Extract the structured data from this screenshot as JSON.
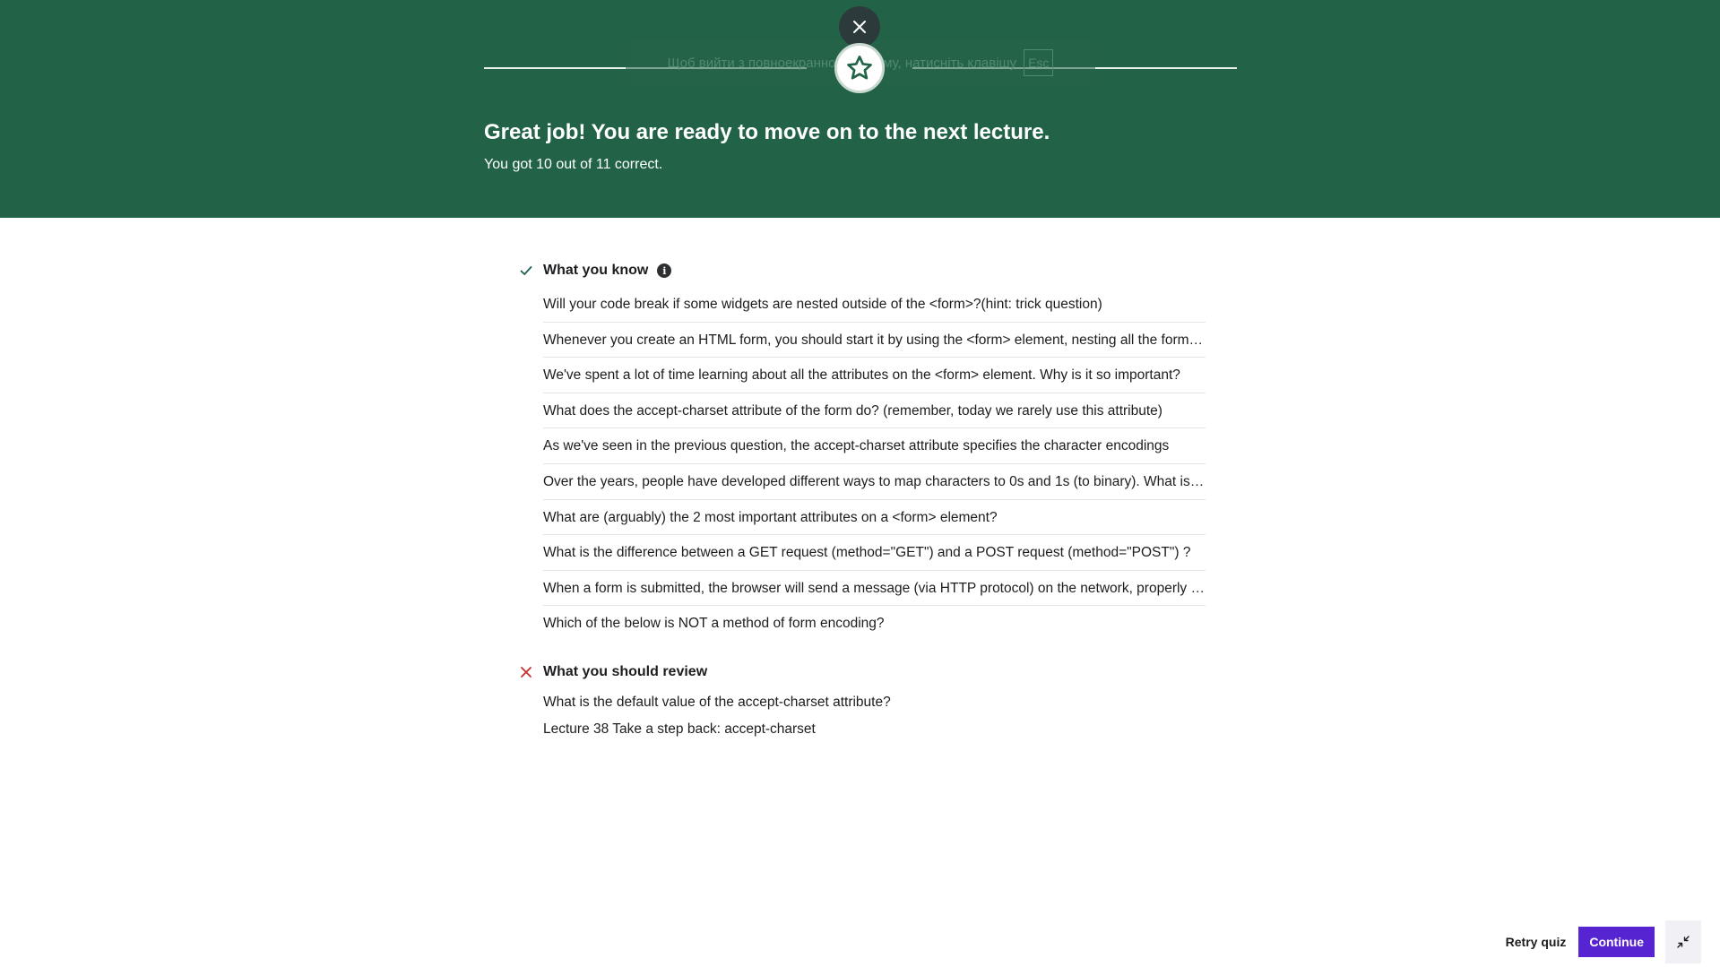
{
  "fullscreen_notice": {
    "text": "Щоб вийти з повноекранного режиму, натисніть клавішу",
    "key": "Esc"
  },
  "banner": {
    "title": "Great job! You are ready to move on to the next lecture.",
    "subtitle": "You got 10 out of 11 correct."
  },
  "know": {
    "label": "What you know",
    "items": [
      "Will your code break if some widgets are nested outside of the <form>?(hint: trick question)",
      "Whenever you create an HTML form, you should start it by using the <form> element, nesting all the form widgets inside it",
      "We've spent a lot of time learning about all the attributes on the <form> element. Why is it so important?",
      "What does the accept-charset attribute of the form do? (remember, today we rarely use this attribute)",
      "As we've seen in the previous question, the accept-charset attribute specifies the character encodings",
      "Over the years, people have developed different ways to map characters to 0s and 1s (to binary). What is this called?",
      "What are (arguably) the 2 most important attributes on a <form> element?",
      "What is the difference between a GET request (method=\"GET\") and a POST request (method=\"POST\") ?",
      "When a form is submitted, the browser will send a message (via HTTP protocol) on the network, properly formatted",
      "Which of the below is NOT a method of form encoding?"
    ]
  },
  "review": {
    "label": "What you should review",
    "question": "What is the default value of the accept-charset attribute?",
    "lecture": "Lecture 38 Take a step back: accept-charset"
  },
  "footer": {
    "retry_label": "Retry quiz",
    "continue_label": "Continue"
  },
  "colors": {
    "banner": "#226348",
    "accent": "#5624d0",
    "check": "#1e6055",
    "cross": "#c4302b"
  }
}
